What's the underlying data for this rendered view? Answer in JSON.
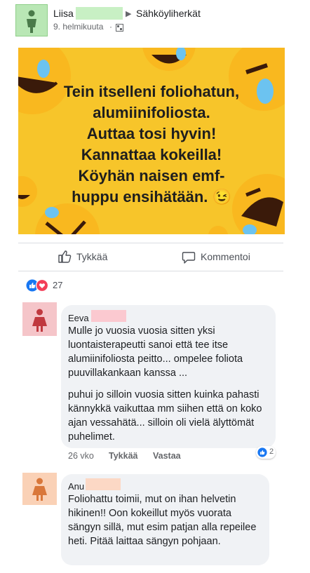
{
  "post": {
    "author_name": "Liisa",
    "group_arrow": "▶",
    "group_name": "Sähköyliherkät",
    "date": "9. helmikuuta",
    "meme_lines": [
      "Tein itselleni foliohatun,",
      "alumiinifoliosta.",
      "Auttaa tosi hyvin!",
      "Kannattaa kokeilla!",
      "Köyhän naisen emf-",
      "huppu ensihätään. 😉"
    ]
  },
  "actions": {
    "like_label": "Tykkää",
    "comment_label": "Kommentoi"
  },
  "reactions": {
    "count": "27"
  },
  "comments": [
    {
      "name": "Eeva",
      "paragraph1": "Mulle jo vuosia vuosia sitten yksi luontaisterapeutti sanoi että tee itse alumiinifoliosta peitto... ompelee foliota puuvillakankaan kanssa ...",
      "paragraph2": "puhui jo silloin vuosia sitten kuinka pahasti kännykkä vaikuttaa mm siihen että on koko ajan vessahätä... silloin oli vielä älyttömät puhelimet.",
      "age": "26 vko",
      "like_label": "Tykkää",
      "reply_label": "Vastaa",
      "reaction_count": "2"
    },
    {
      "name": "Anu",
      "paragraph1": "Foliohattu toimii, mut on ihan helvetin hikinen!! Oon kokeillut myös vuorata sängyn sillä, mut esim patjan alla repeilee heti. Pitää laittaa sängyn pohjaan."
    }
  ],
  "colors": {
    "meme_background": "#f7c52a",
    "like_blue": "#1877f2",
    "love_red": "#f33e58",
    "bubble_gray": "#f0f2f5"
  },
  "icons": [
    "person-avatar-icon",
    "globe-icon",
    "thumbs-up-icon",
    "comment-icon",
    "like-reaction-icon",
    "love-reaction-icon",
    "laughing-emoji-icon"
  ]
}
